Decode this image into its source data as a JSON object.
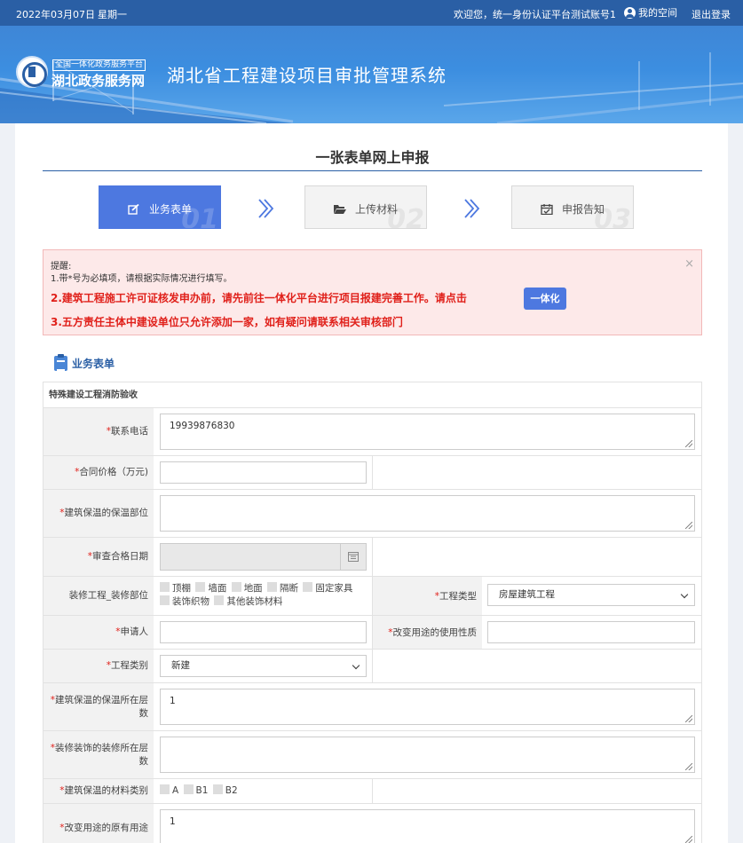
{
  "topbar": {
    "date": "2022年03月07日",
    "weekday": "星期一",
    "welcome": "欢迎您，统一身份认证平台测试账号1",
    "my_space": "我的空间",
    "logout": "退出登录"
  },
  "banner": {
    "logo_tag": "全国一体化政务服务平台",
    "logo_name": "湖北政务服务网",
    "system_title": "湖北省工程建设项目审批管理系统"
  },
  "page_title": "一张表单网上申报",
  "steps": [
    {
      "label": "业务表单",
      "num": "01",
      "active": true
    },
    {
      "label": "上传材料",
      "num": "02",
      "active": false
    },
    {
      "label": "申报告知",
      "num": "03",
      "active": false
    }
  ],
  "alert": {
    "title": "提醒:",
    "line1": "1.带*号为必填项，请根据实际情况进行填写。",
    "line2": "2.建筑工程施工许可证核发申办前，请先前往一体化平台进行项目报建完善工作。请点击",
    "button": "一体化",
    "line3": "3.五方责任主体中建设单位只允许添加一家，如有疑问请联系相关审核部门",
    "close": "×"
  },
  "section_title": "业务表单",
  "form": {
    "caption": "特殊建设工程消防验收",
    "required_mark": "*",
    "phone": {
      "label": "联系电话",
      "value": "19939876830"
    },
    "contract_price": {
      "label": "合同价格（万元)",
      "value": ""
    },
    "insulation_part": {
      "label": "建筑保温的保温部位",
      "value": ""
    },
    "review_date": {
      "label": "审查合格日期",
      "value": ""
    },
    "decoration": {
      "label": "装修工程_装修部位",
      "options": [
        "顶棚",
        "墙面",
        "地面",
        "隔断",
        "固定家具",
        "装饰织物",
        "其他装饰材料"
      ]
    },
    "project_type": {
      "label": "工程类型",
      "value": "房屋建筑工程"
    },
    "applicant": {
      "label": "申请人",
      "value": ""
    },
    "use_nature": {
      "label": "改变用途的使用性质",
      "value": ""
    },
    "project_category": {
      "label": "工程类别",
      "value": "新建"
    },
    "insulation_floors": {
      "label": "建筑保温的保温所在层数",
      "value": "1"
    },
    "decoration_floors": {
      "label": "装修装饰的装修所在层数",
      "value": ""
    },
    "material_class": {
      "label": "建筑保温的材料类别",
      "options": [
        "A",
        "B1",
        "B2"
      ]
    },
    "original_use": {
      "label": "改变用途的原有用途",
      "value": "1"
    }
  }
}
